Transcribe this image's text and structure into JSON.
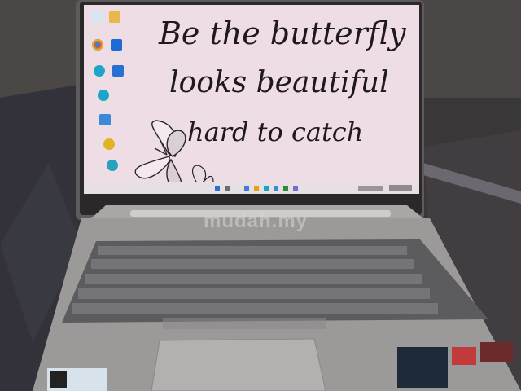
{
  "wallpaper": {
    "line1": "Be the butterfly",
    "line2": "looks beautiful",
    "line3": "hard to catch",
    "background": "#efdde6",
    "ink": "#1e1a1c"
  },
  "desktop_icons": [
    "recycle-bin-icon",
    "folder-icon",
    "chrome-icon",
    "app-icon",
    "edge-icon",
    "store-icon",
    "edge-icon",
    "folder-icon",
    "app-icon",
    "edge-icon"
  ],
  "watermark": "mudah.my",
  "colors": {
    "laptop_body": "#bcbab8",
    "keyboard": "#4a4a4c",
    "desk": "#2e2c2e"
  }
}
